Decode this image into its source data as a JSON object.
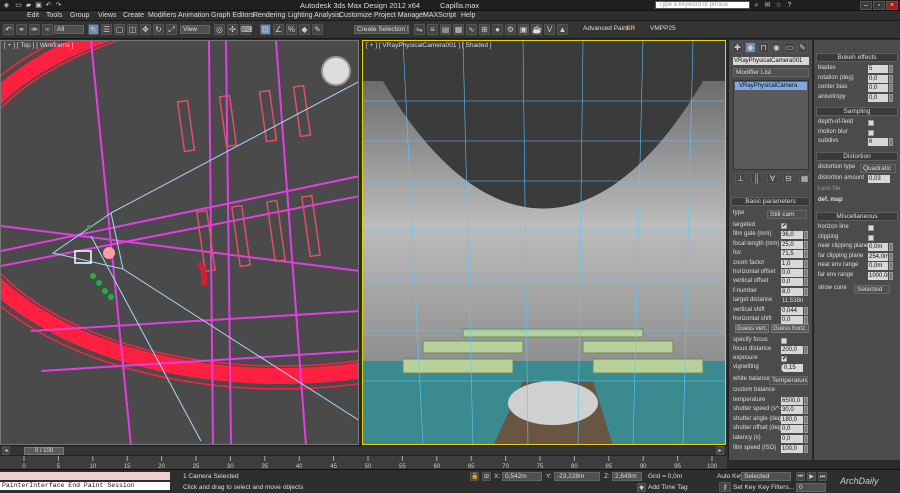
{
  "window": {
    "app_title": "Autodesk 3ds Max Design 2012 x64",
    "file_name": "Capilla.max",
    "search_placeholder": "Type a keyword or phrase"
  },
  "menu": [
    "Edit",
    "Tools",
    "Group",
    "Views",
    "Create",
    "Modifiers",
    "Animation",
    "Graph Editors",
    "Rendering",
    "Lighting Analysis",
    "Customize",
    "Project Manager",
    "MAXScript",
    "Help"
  ],
  "toolbar": {
    "filter_value": "All",
    "ref_coord": "View",
    "named_selection": "Create Selection Set",
    "advanced_paint": "Advanced Paint",
    "sr_label": "SR",
    "vmpp": "VMPP25"
  },
  "viewports": {
    "left_label": "[ + ] [ Top ] [ Wireframe ]",
    "right_label": "[ + ] [ VRayPhysicalCamera001 ] [ Shaded ]"
  },
  "command_panel": {
    "object_name": "VRayPhysicalCamera001",
    "modifier_list": "Modifier List",
    "stack_item": "VRayPhysicalCamera",
    "basic_parameters": "Basic parameters",
    "type_label": "type",
    "type_value": "Still cam",
    "params": [
      {
        "label": "targeted",
        "kind": "check",
        "value": "✔"
      },
      {
        "label": "film gate (mm)",
        "kind": "num",
        "value": "36,0"
      },
      {
        "label": "focal length (mm)",
        "kind": "num",
        "value": "25,0"
      },
      {
        "label": "fov",
        "kind": "num",
        "value": "71,5"
      },
      {
        "label": "zoom factor",
        "kind": "num",
        "value": "1,0"
      },
      {
        "label": "horizontal offset",
        "kind": "num",
        "value": "0,0"
      },
      {
        "label": "vertical offset",
        "kind": "num",
        "value": "0,0"
      },
      {
        "label": "f-number",
        "kind": "num",
        "value": "8,0"
      },
      {
        "label": "target distance",
        "kind": "text",
        "value": "11,538m"
      },
      {
        "label": "vertical shift",
        "kind": "num",
        "value": "0,044"
      },
      {
        "label": "horizontal shift",
        "kind": "num",
        "value": "0,0"
      }
    ],
    "guess_vert": "Guess vert.",
    "guess_horiz": "Guess horiz.",
    "params2": [
      {
        "label": "specify focus",
        "kind": "check",
        "value": ""
      },
      {
        "label": "focus distance",
        "kind": "num",
        "value": "200,0"
      },
      {
        "label": "exposure",
        "kind": "check",
        "value": "✔"
      },
      {
        "label": "vignetting",
        "kind": "check",
        "value": "✔"
      }
    ],
    "vignetting_value": "0,15",
    "white_balance_label": "white balance",
    "white_balance_value": "Temperature",
    "params3": [
      {
        "label": "custom balance",
        "kind": "text",
        "value": ""
      },
      {
        "label": "temperature",
        "kind": "num",
        "value": "6500,0"
      },
      {
        "label": "shutter speed (s^-1)",
        "kind": "num",
        "value": "30,0"
      },
      {
        "label": "shutter angle (deg)",
        "kind": "num",
        "value": "180,0"
      },
      {
        "label": "shutter offset (deg)",
        "kind": "num",
        "value": "0,0"
      },
      {
        "label": "latency (s)",
        "kind": "num",
        "value": "0,0"
      },
      {
        "label": "film speed (ISO)",
        "kind": "num",
        "value": "100,0"
      }
    ]
  },
  "camera_panel": {
    "bokeh_title": "Bokeh effects",
    "bokeh": [
      {
        "label": "blades",
        "value": "5"
      },
      {
        "label": "rotation (deg)",
        "value": "0,0"
      },
      {
        "label": "center bias",
        "value": "0,0"
      },
      {
        "label": "anisotropy",
        "value": "0,0"
      }
    ],
    "sampling_title": "Sampling",
    "sampling": [
      {
        "label": "depth-of-field",
        "kind": "check",
        "value": ""
      },
      {
        "label": "motion blur",
        "kind": "check",
        "value": ""
      },
      {
        "label": "subdivs",
        "kind": "num",
        "value": "6"
      }
    ],
    "distortion_title": "Distortion",
    "distortion_type_label": "distortion type",
    "distortion_type_value": "Quadratic",
    "distortion_amount_label": "distortion amount",
    "distortion_amount_value": "0,03",
    "lens_file_label": "Lens file",
    "dot_map_label": "def. map",
    "misc_title": "Miscellaneous",
    "misc": [
      {
        "label": "horizon line",
        "kind": "check",
        "value": ""
      },
      {
        "label": "clipping",
        "kind": "check",
        "value": ""
      },
      {
        "label": "near clipping plane",
        "kind": "num",
        "value": "0,0m"
      },
      {
        "label": "far clipping plane",
        "kind": "num",
        "value": "254,0m"
      },
      {
        "label": "near env range",
        "kind": "num",
        "value": "0,0m"
      },
      {
        "label": "far env range",
        "kind": "num",
        "value": "1000,0m"
      }
    ],
    "show_cone_label": "show cone",
    "show_cone_value": "Selected"
  },
  "timeline": {
    "frame": "0 / 100",
    "ticks": [
      "0",
      "5",
      "10",
      "15",
      "20",
      "25",
      "30",
      "35",
      "40",
      "45",
      "50",
      "55",
      "60",
      "65",
      "70",
      "75",
      "80",
      "85",
      "90",
      "95",
      "100"
    ]
  },
  "status": {
    "listener_top": "",
    "listener_bottom": "PainterInterface End Paint Session",
    "selected": "1 Camera Selected",
    "prompt": "Click and drag to select and move objects",
    "x_label": "X:",
    "x": "0,542m",
    "y_label": "Y:",
    "y": "-23,228m",
    "z_label": "Z:",
    "z": "2,649m",
    "grid": "Grid = 0,0m",
    "add_time_tag": "Add Time Tag",
    "auto_key": "Auto Key",
    "auto_key_value": "Selected",
    "set_key": "Set Key",
    "key_filters": "Key Filters...",
    "frame_field": "0",
    "watermark": "ArchDaily"
  },
  "colors": {
    "viewport_active_border": "#e8d400",
    "wire_red": "#ff2040",
    "wire_magenta": "#e040e0",
    "wire_blue": "#6a9fd0"
  }
}
